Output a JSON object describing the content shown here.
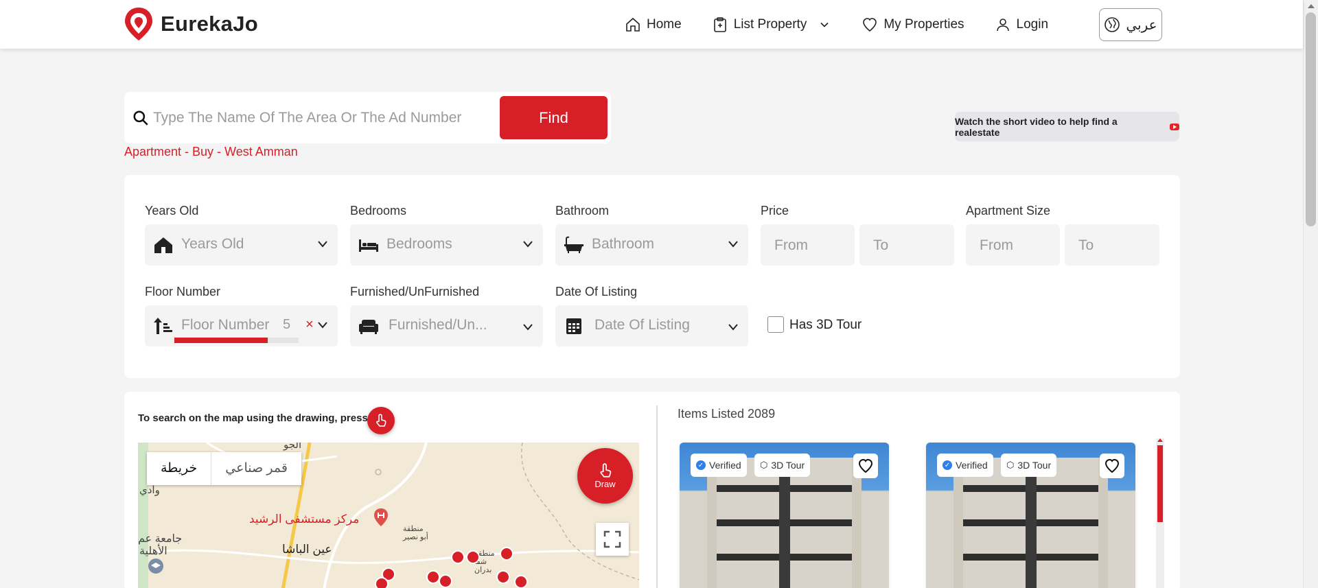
{
  "header": {
    "brand": "EurekaJo",
    "nav": {
      "home": "Home",
      "list_property": "List Property",
      "my_properties": "My Properties",
      "login": "Login"
    },
    "language": "عربي"
  },
  "search": {
    "placeholder": "Type The Name Of The Area Or The Ad Number",
    "value": "",
    "find_label": "Find",
    "hint": "Apartment - Buy - West Amman"
  },
  "video_link": "Watch the short video to help find a realestate",
  "filters": {
    "years_old": {
      "label": "Years Old",
      "placeholder": "Years Old"
    },
    "bedrooms": {
      "label": "Bedrooms",
      "placeholder": "Bedrooms"
    },
    "bathroom": {
      "label": "Bathroom",
      "placeholder": "Bathroom"
    },
    "price": {
      "label": "Price",
      "from": "From",
      "to": "To"
    },
    "apartment_size": {
      "label": "Apartment Size",
      "from": "From",
      "to": "To"
    },
    "floor_number": {
      "label": "Floor Number",
      "placeholder": "Floor Number",
      "value": "5",
      "clear": "×",
      "slider_level": 0.75
    },
    "furnished": {
      "label": "Furnished/UnFurnished",
      "placeholder": "Furnished/Un..."
    },
    "date_of_listing": {
      "label": "Date Of Listing",
      "placeholder": "Date Of Listing"
    },
    "has_3d_tour": {
      "label": "Has 3D Tour",
      "checked": false
    }
  },
  "map_section": {
    "hint": "To search on the map using the drawing, press",
    "map_type": {
      "map": "خريطة",
      "satellite": "قمر صناعي"
    },
    "draw_label": "Draw",
    "place_labels": {
      "hospital": "مركز مستشفى الرشيد",
      "ain_basha": "عين الباشا",
      "mosque": "جامعة عم",
      "ahliyya": "الأهلية",
      "wadi": "وادي",
      "jawhara": "الجو",
      "abu_nseir": "منطقة أبو نصير",
      "shafa_badran": "منطقة شفا بدران"
    }
  },
  "listings": {
    "count_label": "Items Listed 2089",
    "cards": [
      {
        "verified": "Verified",
        "tour": "3D Tour"
      },
      {
        "verified": "Verified",
        "tour": "3D Tour"
      }
    ]
  },
  "colors": {
    "brand_red": "#d71f27",
    "page_bg": "#f4f4f4",
    "verified_blue": "#2f80ed"
  },
  "icons": {
    "home": "home-icon",
    "list_property": "clipboard-plus-icon",
    "my_properties": "heart-icon",
    "login": "user-icon",
    "language": "globe-icon",
    "search": "search-icon",
    "video": "youtube-icon"
  }
}
